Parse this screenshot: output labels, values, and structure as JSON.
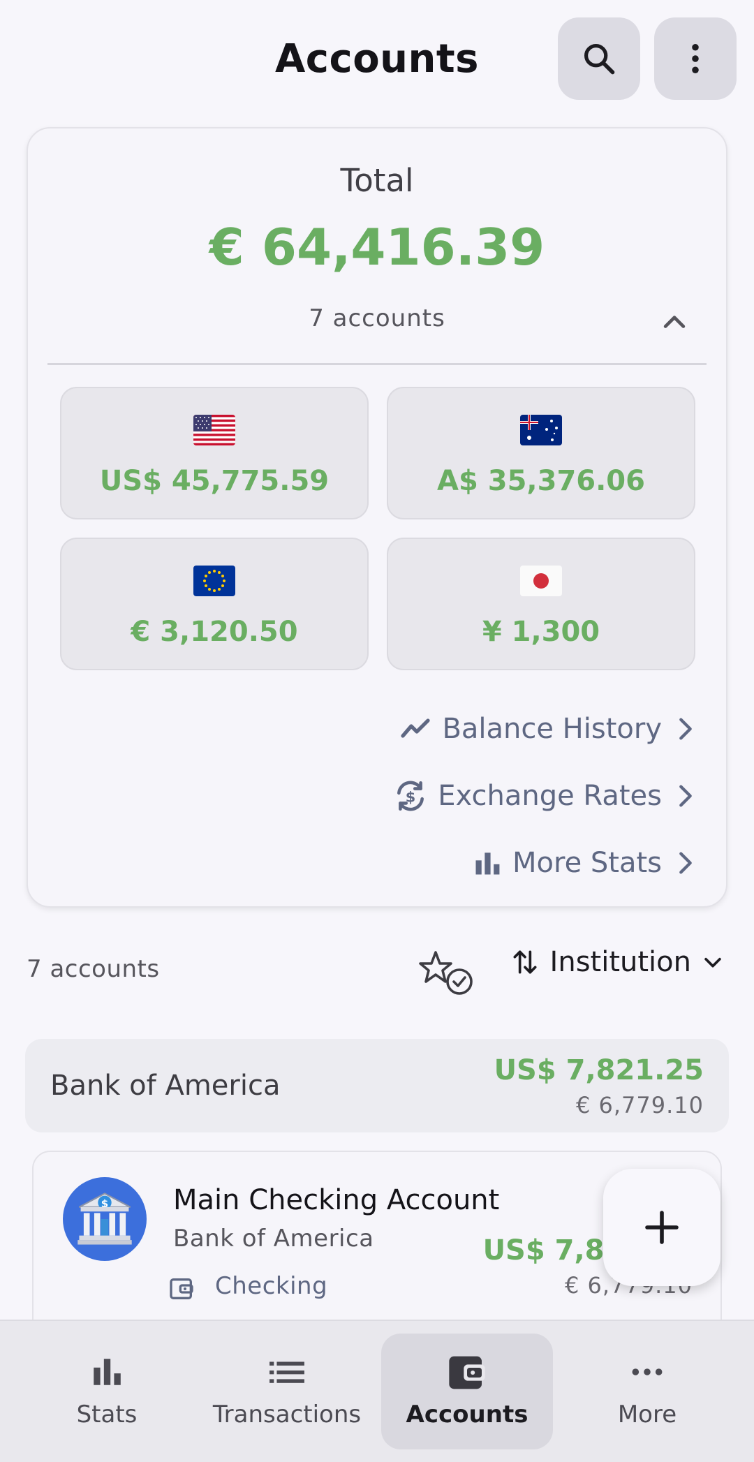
{
  "header": {
    "title": "Accounts"
  },
  "summary": {
    "label": "Total",
    "amount": "€ 64,416.39",
    "accounts_count": "7 accounts",
    "currencies": [
      {
        "flag": "us-flag-icon",
        "amount": "US$ 45,775.59"
      },
      {
        "flag": "au-flag-icon",
        "amount": "A$ 35,376.06"
      },
      {
        "flag": "eu-flag-icon",
        "amount": "€ 3,120.50"
      },
      {
        "flag": "jp-flag-icon",
        "amount": "¥ 1,300"
      }
    ],
    "links": {
      "balance_history": "Balance History",
      "exchange_rates": "Exchange Rates",
      "more_stats": "More Stats"
    }
  },
  "list": {
    "count": "7 accounts",
    "sort_label": "Institution"
  },
  "group": {
    "name": "Bank of America",
    "amount": "US$ 7,821.25",
    "converted": "€ 6,779.10"
  },
  "account": {
    "name": "Main Checking Account",
    "bank": "Bank of America",
    "type": "Checking",
    "amount": "US$ 7,821.25",
    "converted": "€ 6,779.10"
  },
  "nav": {
    "items": [
      {
        "label": "Stats",
        "icon": "bar-chart-icon"
      },
      {
        "label": "Transactions",
        "icon": "list-icon"
      },
      {
        "label": "Accounts",
        "icon": "wallet-icon",
        "active": true
      },
      {
        "label": "More",
        "icon": "more-horizontal-icon"
      }
    ]
  },
  "colors": {
    "positive": "#6aae62",
    "accent_blue": "#3c6fdc",
    "link": "#5e6782"
  }
}
